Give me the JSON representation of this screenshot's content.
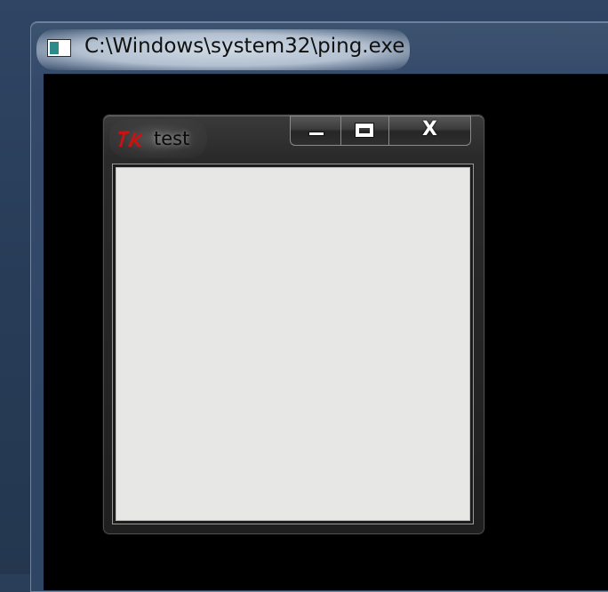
{
  "console_window": {
    "title": "C:\\Windows\\system32\\ping.exe",
    "icon": "console-app-icon",
    "client_background": "#000000"
  },
  "tk_window": {
    "title": "test",
    "icon": "tk-feather-icon",
    "icon_color": "#cc1111",
    "client_background": "#e7e7e6",
    "buttons": {
      "minimize": "minimize-icon",
      "maximize": "maximize-icon",
      "close_label": "X"
    }
  },
  "colors": {
    "desktop": "#2a3e5a",
    "frame_dark": "#1f1f1f"
  }
}
